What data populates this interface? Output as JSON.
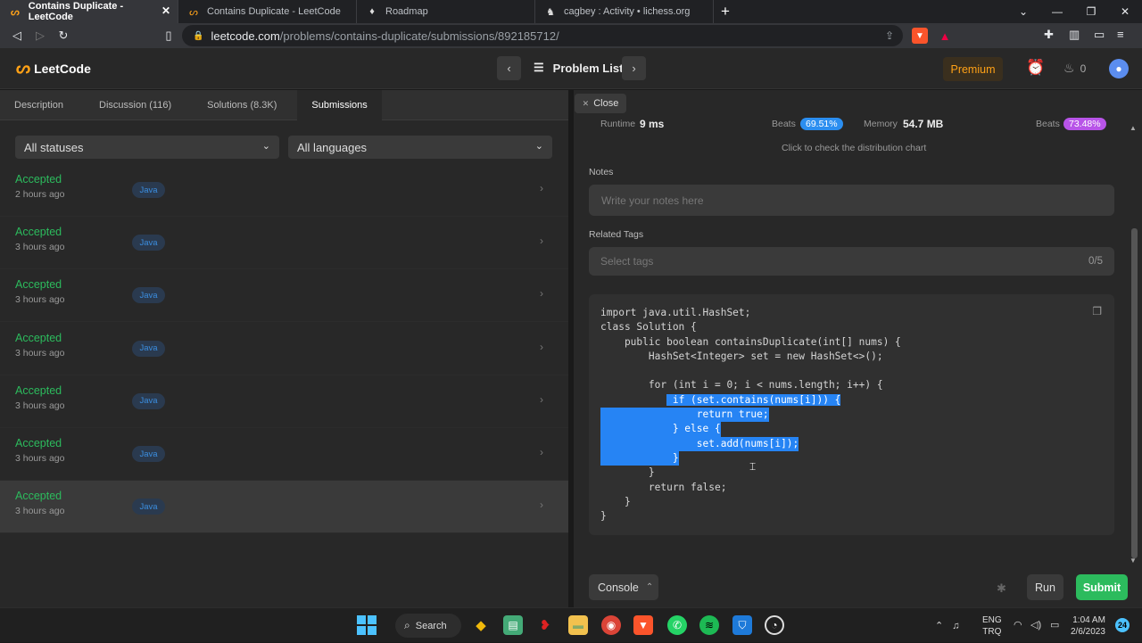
{
  "browser": {
    "tabs": [
      {
        "title": "Contains Duplicate - LeetCode",
        "icon": "leetcode-icon",
        "active": true
      },
      {
        "title": "Contains Duplicate - LeetCode",
        "icon": "leetcode-icon",
        "active": false
      },
      {
        "title": "Roadmap",
        "icon": "rocket-icon",
        "active": false
      },
      {
        "title": "cagbey : Activity • lichess.org",
        "icon": "lichess-icon",
        "active": false
      }
    ],
    "url_domain": "leetcode.com",
    "url_path": "/problems/contains-duplicate/submissions/892185712/"
  },
  "nav": {
    "logo_text": "LeetCode",
    "problem_list": "Problem List",
    "premium": "Premium",
    "streak_count": "0"
  },
  "left": {
    "tabs": [
      "Description",
      "Discussion (116)",
      "Solutions (8.3K)",
      "Submissions"
    ],
    "status_filter": "All statuses",
    "language_filter": "All languages",
    "submissions": [
      {
        "status": "Accepted",
        "time": "2 hours ago",
        "language": "Java"
      },
      {
        "status": "Accepted",
        "time": "3 hours ago",
        "language": "Java"
      },
      {
        "status": "Accepted",
        "time": "3 hours ago",
        "language": "Java"
      },
      {
        "status": "Accepted",
        "time": "3 hours ago",
        "language": "Java"
      },
      {
        "status": "Accepted",
        "time": "3 hours ago",
        "language": "Java"
      },
      {
        "status": "Accepted",
        "time": "3 hours ago",
        "language": "Java"
      },
      {
        "status": "Accepted",
        "time": "3 hours ago",
        "language": "Java"
      }
    ]
  },
  "right": {
    "close_label": "Close",
    "runtime_label": "Runtime",
    "runtime_value": "9 ms",
    "runtime_beats_label": "Beats",
    "runtime_beats": "69.51%",
    "memory_label": "Memory",
    "memory_value": "54.7 MB",
    "memory_beats_label": "Beats",
    "memory_beats": "73.48%",
    "distribution_link": "Click to check the distribution chart",
    "notes_label": "Notes",
    "notes_placeholder": "Write your notes here",
    "tags_label": "Related Tags",
    "tags_placeholder": "Select tags",
    "tags_count": "0/5",
    "code_lines": [
      "import java.util.HashSet;",
      "class Solution {",
      "    public boolean containsDuplicate(int[] nums) {",
      "        HashSet<Integer> set = new HashSet<>();",
      "",
      "        for (int i = 0; i < nums.length; i++) {",
      "            if (set.contains(nums[i])) {",
      "                return true;",
      "            } else {",
      "                set.add(nums[i]);",
      "            }",
      "        }",
      "        return false;",
      "    }",
      "}"
    ],
    "console_label": "Console",
    "run_label": "Run",
    "submit_label": "Submit"
  },
  "taskbar": {
    "search_label": "Search",
    "lang_top": "ENG",
    "lang_bottom": "TRQ",
    "time": "1:04 AM",
    "date": "2/6/2023",
    "notification_count": "24"
  },
  "colors": {
    "accepted": "#2cbb5d",
    "brand": "#ffa116",
    "runtime_beats_bg": "#2b8ef0",
    "memory_beats_bg": "#b854e8",
    "selection": "#2684f4"
  }
}
